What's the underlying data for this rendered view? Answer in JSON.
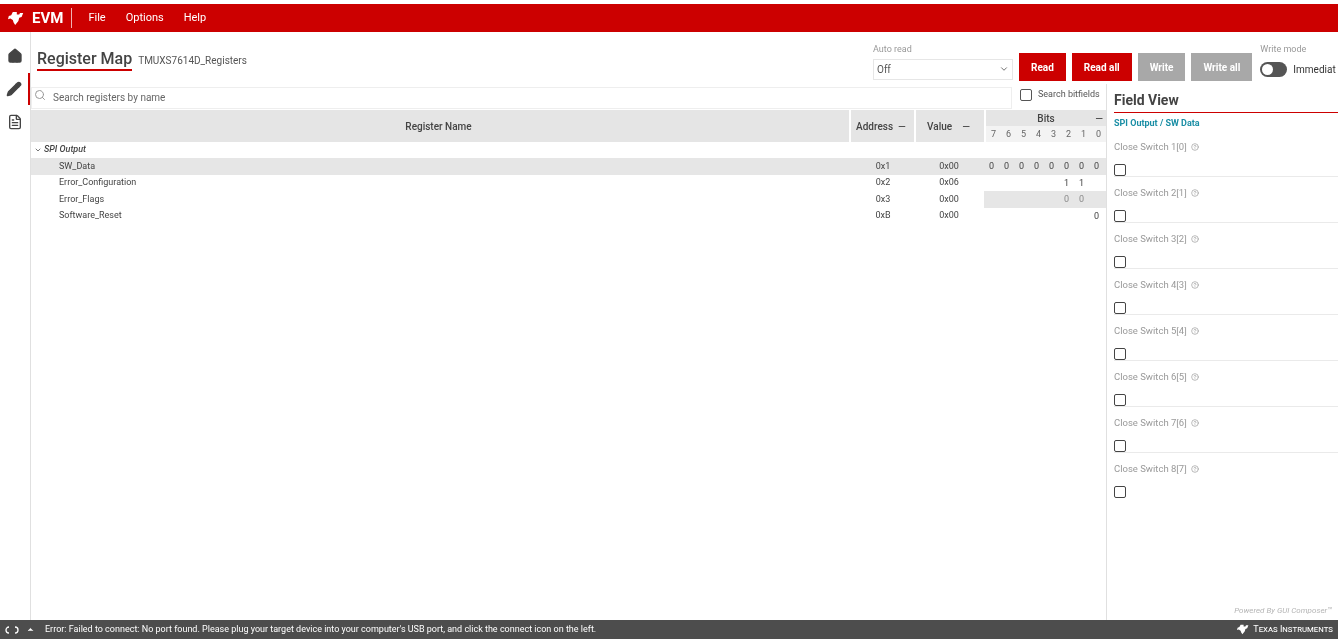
{
  "app_bar": {
    "title": "EVM",
    "menu": [
      "File",
      "Options",
      "Help"
    ]
  },
  "sidebar": {
    "items": [
      {
        "selected": false
      },
      {
        "selected": true
      },
      {
        "selected": false
      }
    ]
  },
  "header": {
    "title": "Register Map",
    "subtitle": "TMUXS7614D_Registers",
    "auto_read": {
      "label": "Auto read",
      "value": "Off"
    },
    "buttons": [
      {
        "label": "Read",
        "disabled": false
      },
      {
        "label": "Read all",
        "disabled": false
      },
      {
        "label": "Write",
        "disabled": true
      },
      {
        "label": "Write all",
        "disabled": true
      }
    ],
    "write_mode": {
      "label": "Write mode",
      "on": false,
      "value": "Immediat"
    }
  },
  "search": {
    "placeholder": "Search registers by name",
    "bitfields": {
      "label": "Search bitfields",
      "checked": false
    }
  },
  "table": {
    "columns": [
      "Register Name",
      "Address",
      "Value",
      "Bits"
    ],
    "column_toggle": "—",
    "bit_positions": [
      "7",
      "6",
      "5",
      "4",
      "3",
      "2",
      "1",
      "0"
    ],
    "groups": [
      {
        "name": "SPI Output",
        "expanded": true,
        "rows": [
          {
            "name": "SW_Data",
            "address": "0x1",
            "value": "0x00",
            "selected": true,
            "readonly": false,
            "bits": {
              "7": "0",
              "6": "0",
              "5": "0",
              "4": "0",
              "3": "0",
              "2": "0",
              "1": "0",
              "0": "0"
            }
          },
          {
            "name": "Error_Configuration",
            "address": "0x2",
            "value": "0x06",
            "selected": false,
            "readonly": false,
            "bits": {
              "2": "1",
              "1": "1"
            }
          },
          {
            "name": "Error_Flags",
            "address": "0x3",
            "value": "0x00",
            "selected": false,
            "readonly": true,
            "bits": {
              "2": "0",
              "1": "0"
            }
          },
          {
            "name": "Software_Reset",
            "address": "0xB",
            "value": "0x00",
            "selected": false,
            "readonly": false,
            "bits": {
              "0": "0"
            }
          }
        ]
      }
    ]
  },
  "field_view": {
    "title": "Field View",
    "path": "SPI Output / SW Data",
    "fields": [
      {
        "label": "Close Switch 1[0]",
        "checked": false
      },
      {
        "label": "Close Switch 2[1]",
        "checked": false
      },
      {
        "label": "Close Switch 3[2]",
        "checked": false
      },
      {
        "label": "Close Switch 4[3]",
        "checked": false
      },
      {
        "label": "Close Switch 5[4]",
        "checked": false
      },
      {
        "label": "Close Switch 6[5]",
        "checked": false
      },
      {
        "label": "Close Switch 7[6]",
        "checked": false
      },
      {
        "label": "Close Switch 8[7]",
        "checked": false
      }
    ],
    "footer": "Powered By GUI Composer™"
  },
  "status_bar": {
    "message": "Error: Failed to connect: No port found. Please plug your target device into your computer's USB port, and click the connect icon on the left.",
    "brand": "Texas Instruments"
  }
}
